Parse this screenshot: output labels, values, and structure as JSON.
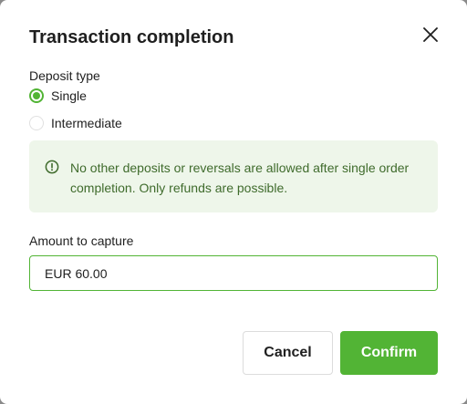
{
  "dialog": {
    "title": "Transaction completion",
    "close_icon": "close-icon"
  },
  "deposit": {
    "label": "Deposit type",
    "options": [
      {
        "label": "Single",
        "checked": true
      },
      {
        "label": "Intermediate",
        "checked": false
      }
    ]
  },
  "notice": {
    "icon": "info-circle-icon",
    "text": "No other deposits or reversals are allowed after single order completion. Only refunds are possible."
  },
  "amount": {
    "label": "Amount to capture",
    "value": "EUR 60.00"
  },
  "buttons": {
    "cancel": "Cancel",
    "confirm": "Confirm"
  },
  "colors": {
    "accent": "#52b435",
    "notice_bg": "#eef6ea",
    "notice_text": "#3f6b2c"
  }
}
